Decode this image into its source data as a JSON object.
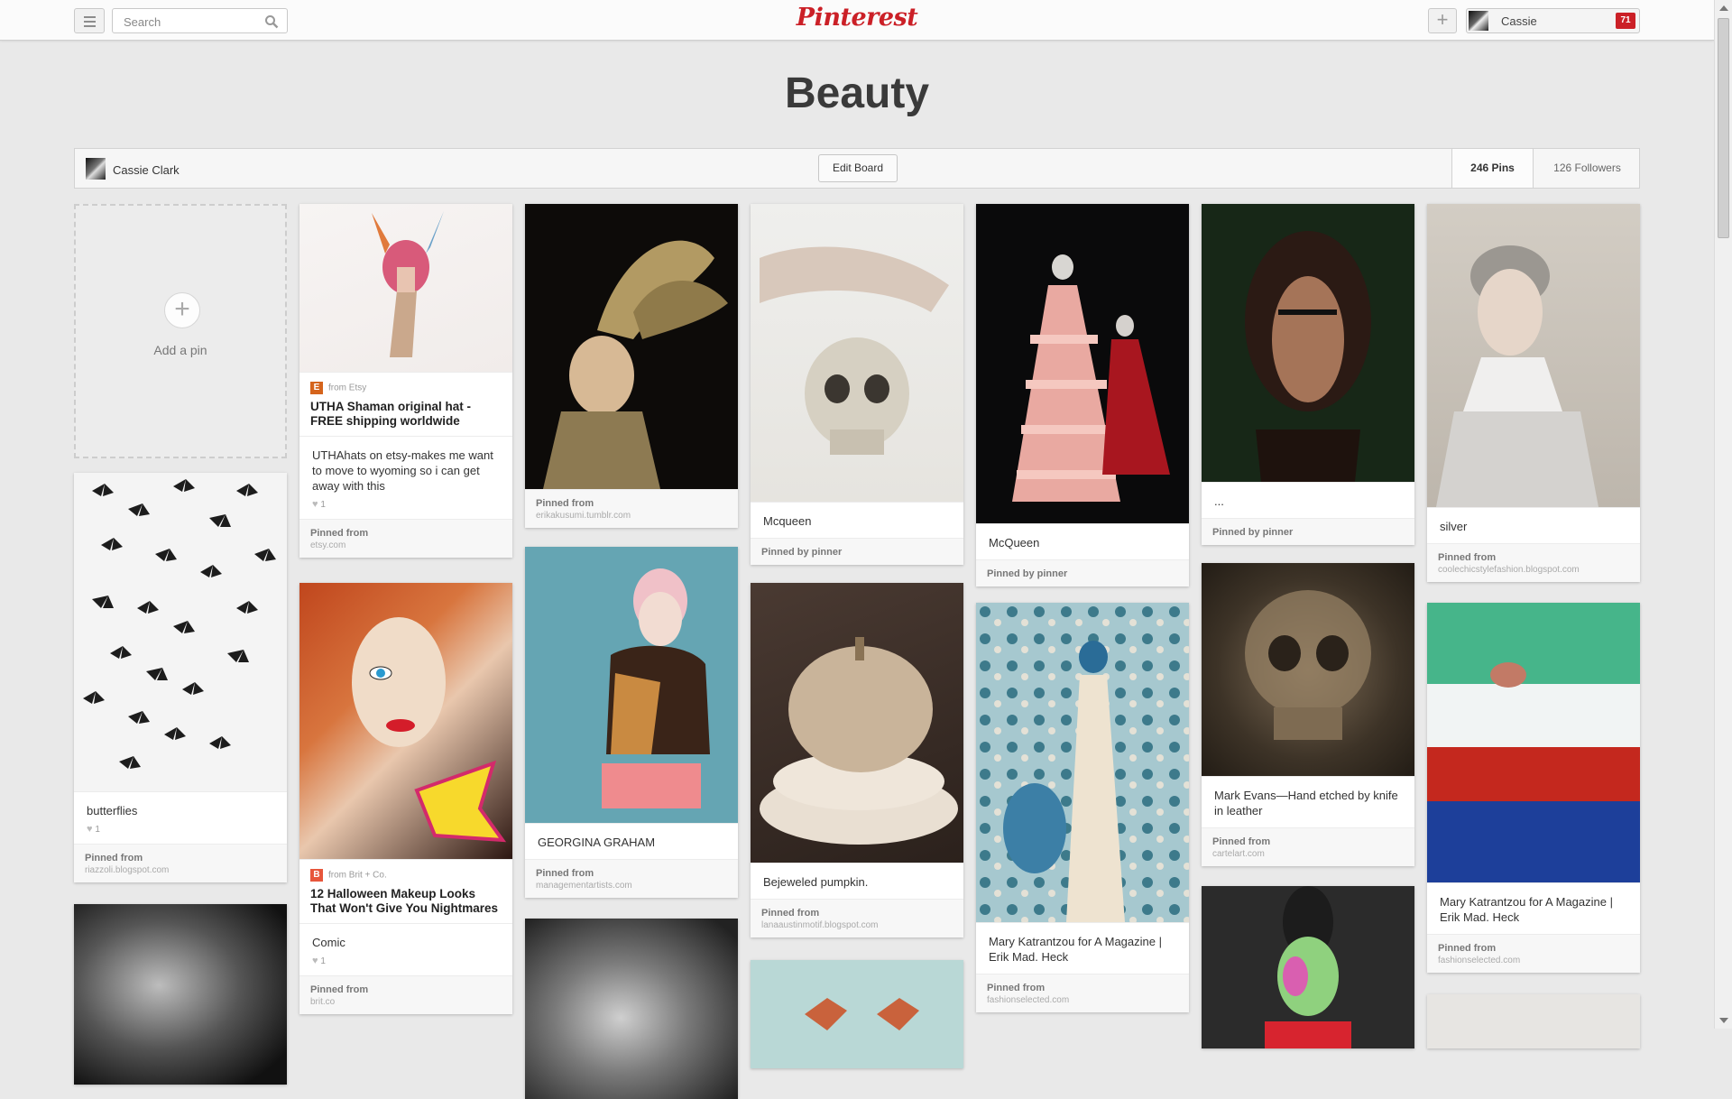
{
  "header": {
    "search_placeholder": "Search",
    "logo": "Pinterest",
    "add_label": "+",
    "user_name": "Cassie",
    "notifications": "71"
  },
  "board": {
    "title": "Beauty",
    "owner": "Cassie Clark",
    "edit_label": "Edit Board",
    "pins_count": "246 Pins",
    "followers_count": "126 Followers"
  },
  "add_pin": {
    "plus": "+",
    "label": "Add a pin"
  },
  "pins": {
    "butterflies": {
      "desc": "butterflies",
      "likes": "1",
      "foot_label": "Pinned from",
      "foot_domain": "riazzoli.blogspot.com"
    },
    "utha": {
      "source": "from Etsy",
      "badge": "E",
      "title": "UTHA Shaman original hat - FREE shipping worldwide",
      "desc": "UTHAhats on etsy-makes me want to move to wyoming so i can get away with this",
      "likes": "1",
      "foot_label": "Pinned from",
      "foot_domain": "etsy.com"
    },
    "halloween": {
      "source": "from Brit + Co.",
      "badge": "B",
      "title": "12 Halloween Makeup Looks That Won't Give You Nightmares",
      "desc": "Comic",
      "likes": "1",
      "foot_label": "Pinned from",
      "foot_domain": "brit.co"
    },
    "bird_hat": {
      "foot_label": "Pinned from",
      "foot_domain": "erikakusumi.tumblr.com"
    },
    "georgina": {
      "desc": "GEORGINA GRAHAM",
      "foot_label": "Pinned from",
      "foot_domain": "managementartists.com"
    },
    "skull_mcqueen": {
      "desc": "Mcqueen",
      "foot_label": "Pinned by pinner"
    },
    "pumpkin": {
      "desc": "Bejeweled pumpkin.",
      "foot_label": "Pinned from",
      "foot_domain": "lanaaustinmotif.blogspot.com"
    },
    "pink_gown": {
      "desc": "McQueen",
      "foot_label": "Pinned by pinner"
    },
    "katrantzou1": {
      "desc": "Mary Katrantzou for A Magazine | Erik Mad. Heck",
      "foot_label": "Pinned from",
      "foot_domain": "fashionselected.com"
    },
    "lace_mask": {
      "desc": "...",
      "foot_label": "Pinned by pinner"
    },
    "carved_skull": {
      "desc": "Mark Evans—Hand etched by knife in leather",
      "foot_label": "Pinned from",
      "foot_domain": "cartelart.com"
    },
    "silver": {
      "desc": "silver",
      "foot_label": "Pinned from",
      "foot_domain": "coolechicstylefashion.blogspot.com"
    },
    "katrantzou2": {
      "desc": "Mary Katrantzou for A Magazine | Erik Mad. Heck",
      "foot_label": "Pinned from",
      "foot_domain": "fashionselected.com"
    }
  },
  "colors": {
    "brand": "#cb2027",
    "background": "#e9e9e9"
  }
}
